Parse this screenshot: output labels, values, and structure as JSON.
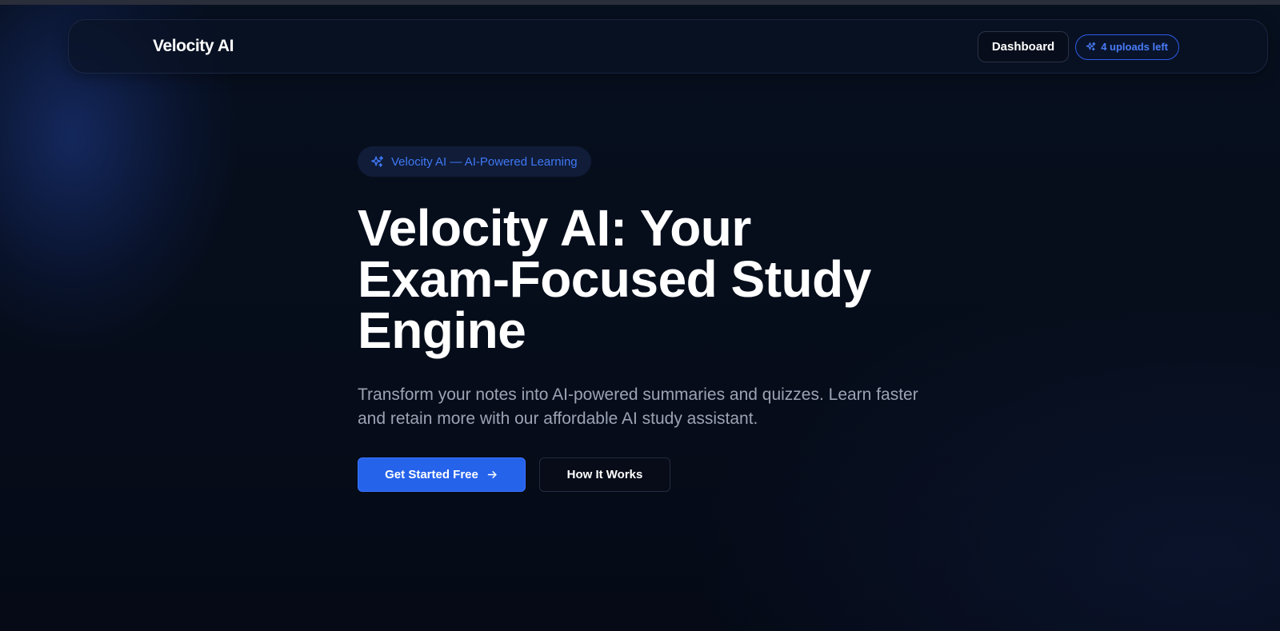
{
  "navbar": {
    "brand": "Velocity AI",
    "dashboard_label": "Dashboard",
    "uploads_label": "4 uploads left",
    "uploads_icon": "sparkles-icon"
  },
  "hero": {
    "badge_label": "Velocity AI — AI-Powered Learning",
    "badge_icon": "sparkles-icon",
    "headline_lines": [
      "Velocity AI: Your",
      "Exam-Focused Study",
      "Engine"
    ],
    "subtitle": "Transform your notes into AI-powered summaries and quizzes. Learn faster and retain more with our affordable AI study assistant.",
    "primary_cta": "Get Started Free",
    "primary_cta_icon": "arrow-right-icon",
    "secondary_cta": "How It Works"
  },
  "colors": {
    "background": "#060b17",
    "accent": "#2563eb",
    "accent_text": "#3f78f5",
    "muted_text": "#9ba3b4"
  }
}
